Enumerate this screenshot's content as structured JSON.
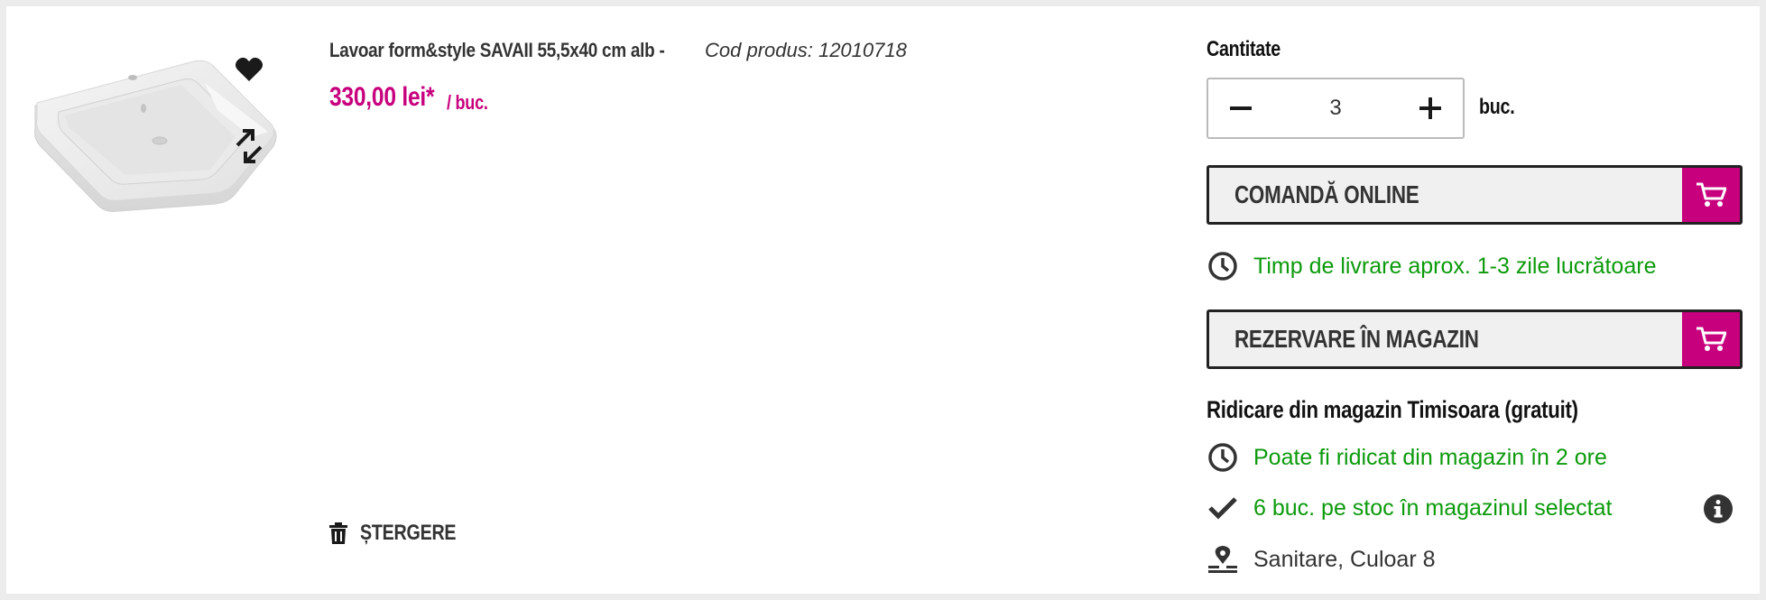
{
  "product": {
    "name": "Lavoar form&style SAVAII 55,5x40 cm alb -",
    "code_text": "Cod produs: 12010718",
    "price": "330,00 lei*",
    "price_unit": "/ buc.",
    "delete_label": "ȘTERGERE"
  },
  "quantity": {
    "label": "Cantitate",
    "value": "3",
    "unit": "buc."
  },
  "actions": {
    "order_online": "COMANDĂ ONLINE",
    "reserve_in_store": "REZERVARE ÎN MAGAZIN"
  },
  "delivery": {
    "time_text": "Timp de livrare aprox. 1-3 zile lucrătoare"
  },
  "pickup": {
    "title": "Ridicare din magazin Timisoara (gratuit)",
    "ready_text": "Poate fi ridicat din magazin în 2 ore",
    "stock_text": "6 buc. pe stoc în magazinul selectat",
    "location_text": "Sanitare, Culoar 8"
  },
  "colors": {
    "accent": "#c7007d",
    "success": "#0c9a0c",
    "text": "#333333"
  },
  "icons": [
    "heart-icon",
    "compare-icon",
    "trash-icon",
    "minus-icon",
    "plus-icon",
    "cart-icon",
    "clock-icon",
    "check-icon",
    "location-icon",
    "info-icon"
  ]
}
